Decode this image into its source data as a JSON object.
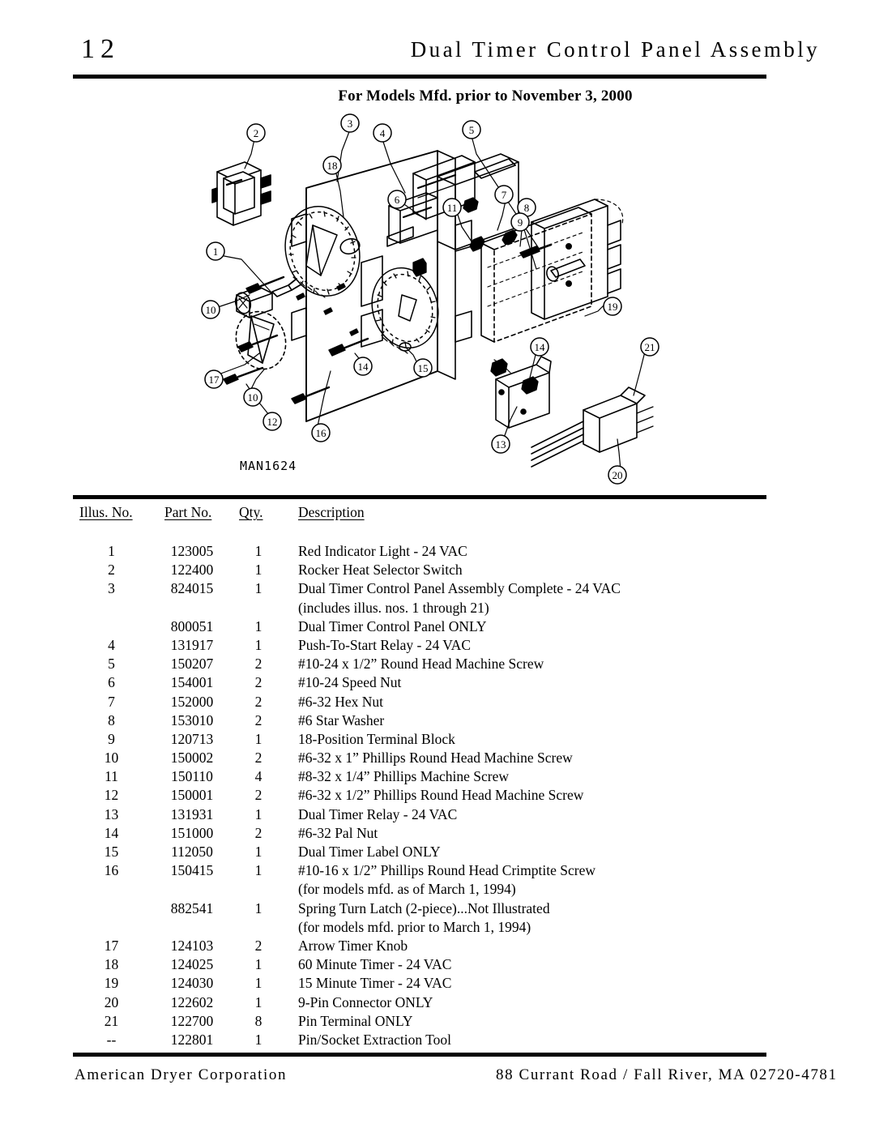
{
  "header": {
    "page_number": "12",
    "title": "Dual Timer Control Panel Assembly",
    "subtitle": "For Models Mfd. prior to November 3, 2000"
  },
  "diagram": {
    "drawing_number": "MAN1624",
    "callouts": [
      "1",
      "2",
      "3",
      "4",
      "5",
      "6",
      "7",
      "8",
      "9",
      "10",
      "11",
      "12",
      "13",
      "14",
      "15",
      "16",
      "17",
      "18",
      "19",
      "20",
      "21"
    ]
  },
  "table": {
    "columns": {
      "illus": "Illus. No.",
      "part": "Part No.",
      "qty": "Qty.",
      "description": "Description"
    },
    "rows": [
      {
        "illus": "1",
        "part": "123005",
        "qty": "1",
        "description": "Red Indicator Light - 24 VAC"
      },
      {
        "illus": "2",
        "part": "122400",
        "qty": "1",
        "description": "Rocker Heat Selector Switch"
      },
      {
        "illus": "3",
        "part": "824015",
        "qty": "1",
        "description": "Dual Timer Control Panel Assembly Complete - 24 VAC"
      },
      {
        "illus": "",
        "part": "",
        "qty": "",
        "description": "(includes illus. nos. 1 through 21)",
        "continuation": true
      },
      {
        "illus": "",
        "part": "800051",
        "qty": "1",
        "description": "Dual Timer Control Panel ONLY"
      },
      {
        "illus": "4",
        "part": "131917",
        "qty": "1",
        "description": "Push-To-Start Relay - 24 VAC"
      },
      {
        "illus": "5",
        "part": "150207",
        "qty": "2",
        "description": "#10-24 x 1/2” Round Head Machine Screw"
      },
      {
        "illus": "6",
        "part": "154001",
        "qty": "2",
        "description": "#10-24 Speed Nut"
      },
      {
        "illus": "7",
        "part": "152000",
        "qty": "2",
        "description": "#6-32 Hex Nut"
      },
      {
        "illus": "8",
        "part": "153010",
        "qty": "2",
        "description": "#6 Star Washer"
      },
      {
        "illus": "9",
        "part": "120713",
        "qty": "1",
        "description": "18-Position Terminal Block"
      },
      {
        "illus": "10",
        "part": "150002",
        "qty": "2",
        "description": "#6-32 x 1” Phillips Round Head Machine Screw"
      },
      {
        "illus": "11",
        "part": "150110",
        "qty": "4",
        "description": "#8-32 x 1/4” Phillips Machine Screw"
      },
      {
        "illus": "12",
        "part": "150001",
        "qty": "2",
        "description": "#6-32 x 1/2” Phillips Round Head Machine Screw"
      },
      {
        "illus": "13",
        "part": "131931",
        "qty": "1",
        "description": "Dual Timer Relay - 24 VAC"
      },
      {
        "illus": "14",
        "part": "151000",
        "qty": "2",
        "description": "#6-32 Pal Nut"
      },
      {
        "illus": "15",
        "part": "112050",
        "qty": "1",
        "description": "Dual Timer Label ONLY"
      },
      {
        "illus": "16",
        "part": "150415",
        "qty": "1",
        "description": "#10-16 x 1/2” Phillips Round Head Crimptite Screw"
      },
      {
        "illus": "",
        "part": "",
        "qty": "",
        "description": "(for models mfd. as of March 1, 1994)",
        "continuation": true
      },
      {
        "illus": "",
        "part": "882541",
        "qty": "1",
        "description": "Spring Turn Latch (2-piece)...Not Illustrated"
      },
      {
        "illus": "",
        "part": "",
        "qty": "",
        "description": "(for models mfd. prior to March 1, 1994)",
        "continuation": true
      },
      {
        "illus": "17",
        "part": "124103",
        "qty": "2",
        "description": "Arrow Timer Knob"
      },
      {
        "illus": "18",
        "part": "124025",
        "qty": "1",
        "description": "60 Minute Timer - 24 VAC"
      },
      {
        "illus": "19",
        "part": "124030",
        "qty": "1",
        "description": "15 Minute Timer - 24 VAC"
      },
      {
        "illus": "20",
        "part": "122602",
        "qty": "1",
        "description": "9-Pin Connector ONLY"
      },
      {
        "illus": "21",
        "part": "122700",
        "qty": "8",
        "description": "Pin Terminal ONLY"
      },
      {
        "illus": "--",
        "part": "122801",
        "qty": "1",
        "description": "Pin/Socket Extraction Tool"
      }
    ]
  },
  "footer": {
    "company": "American Dryer Corporation",
    "address": "88 Currant Road / Fall River, MA 02720-4781"
  }
}
